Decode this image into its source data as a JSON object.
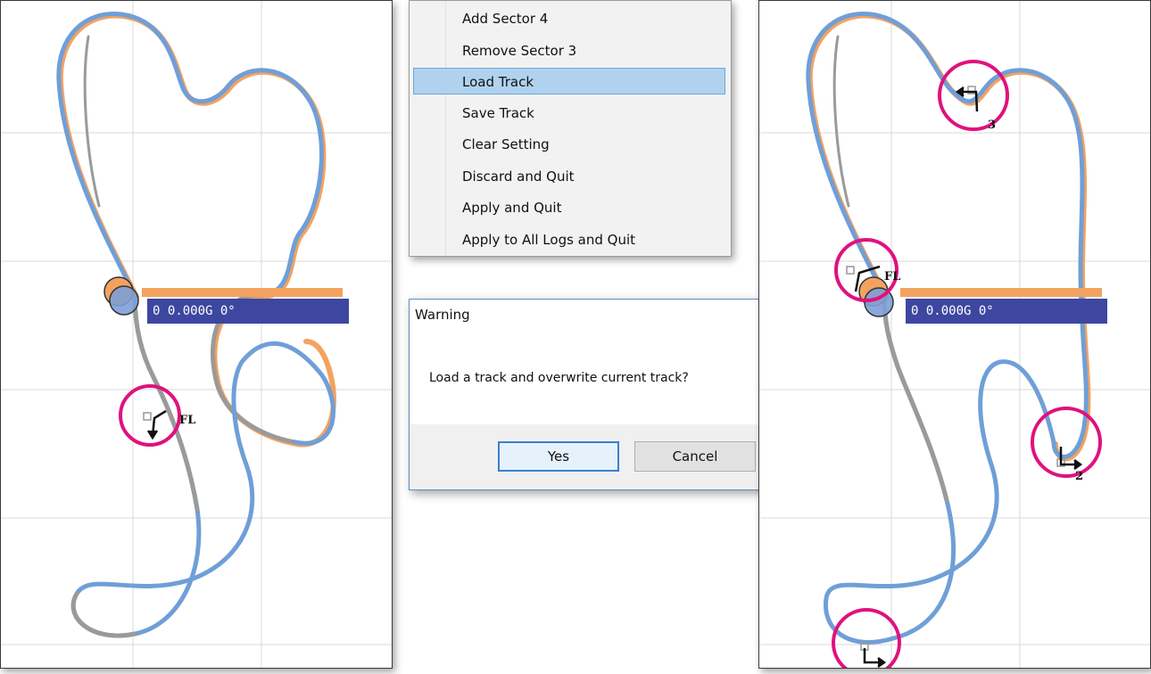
{
  "left_panel": {
    "readout": "0 0.000G 0°",
    "marker_label": "FL"
  },
  "right_panel": {
    "readout": "0 0.000G 0°",
    "marker_labels": {
      "fl": "FL",
      "sector_3": "3",
      "sector_2": "2"
    }
  },
  "context_menu": {
    "items": [
      {
        "label": "Add Sector 4"
      },
      {
        "label": "Remove Sector 3"
      },
      {
        "label": "Load Track",
        "selected": true
      },
      {
        "label": "Save Track"
      },
      {
        "label": "Clear Setting"
      },
      {
        "label": "Discard and Quit"
      },
      {
        "label": "Apply and Quit"
      },
      {
        "label": "Apply to All Logs and Quit"
      }
    ]
  },
  "dialog": {
    "title": "Warning",
    "close_glyph": "✕",
    "message": "Load a track and overwrite current track?",
    "yes_label": "Yes",
    "cancel_label": "Cancel"
  },
  "colors": {
    "track_blue": "#6f9fd8",
    "track_gray": "#9a9a9a",
    "track_orange": "#f4a25f",
    "readout_bar": "#3d47a0",
    "highlight_circle": "#e0117f",
    "menu_selected": "#b0d2ef"
  }
}
